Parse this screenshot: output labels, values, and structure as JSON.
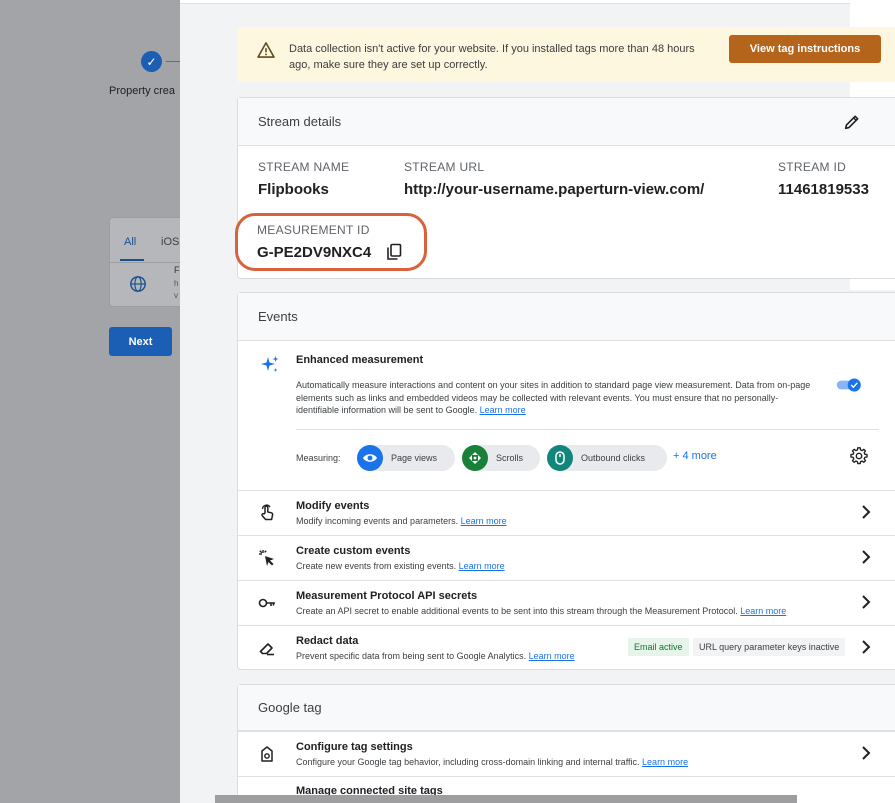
{
  "background": {
    "step_label": "Property crea",
    "tab_all": "All",
    "tab_ios": "iOS",
    "item_initial": "F",
    "item_line2": "h",
    "item_line3": "v",
    "next_button": "Next"
  },
  "warning": {
    "text": "Data collection isn't active for your website. If you installed tags more than 48 hours ago, make sure they are set up correctly.",
    "button": "View tag instructions",
    "color": "#b5641b"
  },
  "stream_details": {
    "title": "Stream details",
    "stream_name_label": "STREAM NAME",
    "stream_name": "Flipbooks",
    "stream_url_label": "STREAM URL",
    "stream_url": "http://your-username.paperturn-view.com/",
    "stream_id_label": "STREAM ID",
    "stream_id": "11461819533",
    "measurement_id_label": "MEASUREMENT ID",
    "measurement_id": "G-PE2DV9NXC4",
    "highlight_color": "#d9623c"
  },
  "events": {
    "title": "Events",
    "enhanced": {
      "title": "Enhanced measurement",
      "description": "Automatically measure interactions and content on your sites in addition to standard page view measurement. Data from on-page elements such as links and embedded videos may be collected with relevant events. You must ensure that no personally-identifiable information will be sent to Google.",
      "learn_more": "Learn more",
      "enabled": true
    },
    "measuring_label": "Measuring:",
    "chips": [
      {
        "label": "Page views",
        "color": "#1a73e8",
        "icon": "eye-icon"
      },
      {
        "label": "Scrolls",
        "color": "#188038",
        "icon": "scroll-icon"
      },
      {
        "label": "Outbound clicks",
        "color": "#12867a",
        "icon": "mouse-icon"
      }
    ],
    "more": "+ 4 more",
    "rows": [
      {
        "title": "Modify events",
        "desc": "Modify incoming events and parameters.",
        "learn_more": "Learn more",
        "icon": "touch-icon"
      },
      {
        "title": "Create custom events",
        "desc": "Create new events from existing events.",
        "learn_more": "Learn more",
        "icon": "sparkle-click-icon"
      },
      {
        "title": "Measurement Protocol API secrets",
        "desc": "Create an API secret to enable additional events to be sent into this stream through the Measurement Protocol.",
        "learn_more": "Learn more",
        "icon": "key-icon"
      },
      {
        "title": "Redact data",
        "desc": "Prevent specific data from being sent to Google Analytics.",
        "learn_more": "Learn more",
        "icon": "eraser-icon",
        "badge_email": "Email active",
        "badge_url": "URL query parameter keys inactive"
      }
    ]
  },
  "google_tag": {
    "title": "Google tag",
    "configure": {
      "title": "Configure tag settings",
      "desc": "Configure your Google tag behavior, including cross-domain linking and internal traffic.",
      "learn_more": "Learn more"
    },
    "next_row_partial": "Manage connected site tags"
  }
}
